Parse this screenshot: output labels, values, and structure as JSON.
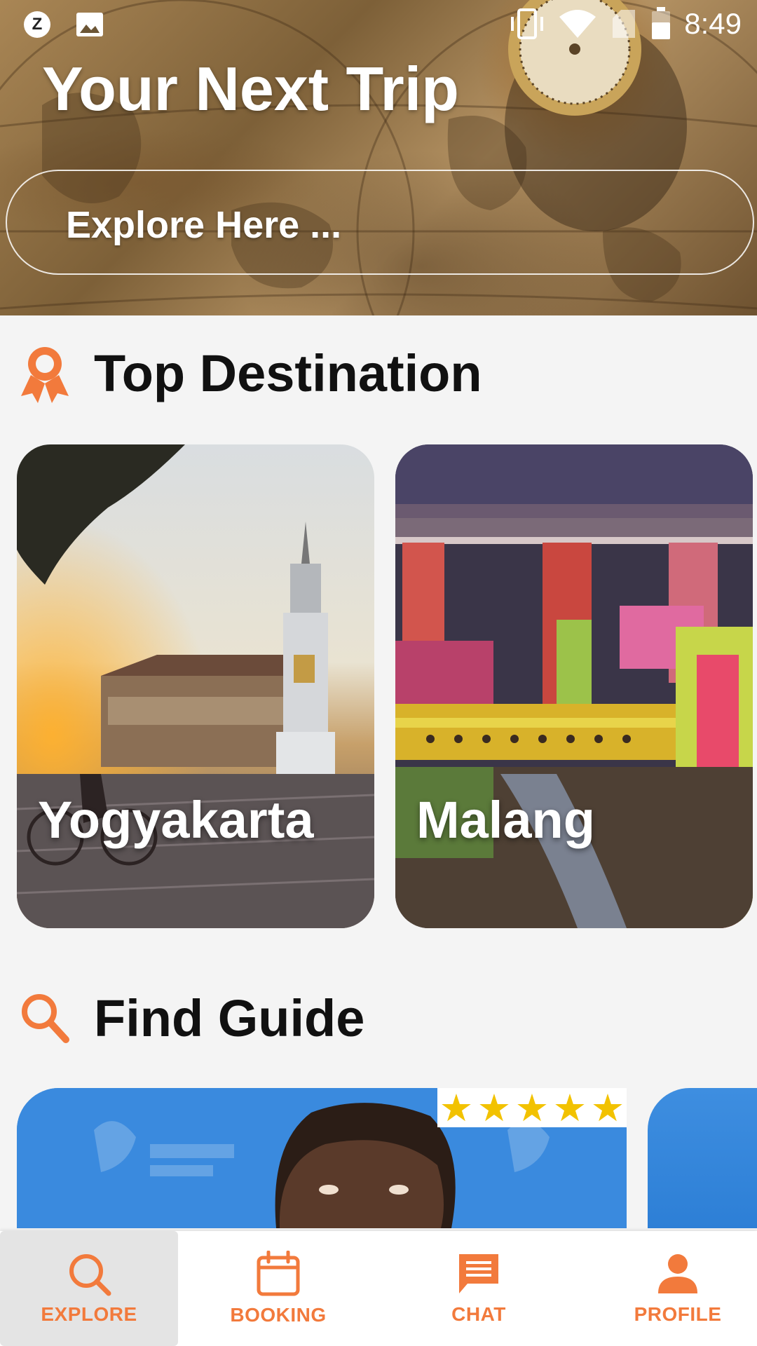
{
  "status_bar": {
    "left_icons": [
      "z-notification-icon",
      "image-icon"
    ],
    "z_letter": "Z",
    "right_icons": [
      "vibrate-icon",
      "wifi-icon",
      "sim-icon",
      "battery-icon"
    ],
    "time": "8:49"
  },
  "hero": {
    "title": "Your Next Trip",
    "search_placeholder": "Explore Here ..."
  },
  "top_destination": {
    "title": "Top Destination",
    "icon": "award-ribbon-icon",
    "cards": [
      {
        "label": "Yogyakarta"
      },
      {
        "label": "Malang"
      }
    ]
  },
  "find_guide": {
    "title": "Find Guide",
    "icon": "search-icon",
    "rating_stars": 5
  },
  "bottom_nav": {
    "items": [
      {
        "label": "EXPLORE",
        "icon": "search-icon",
        "active": true
      },
      {
        "label": "BOOKING",
        "icon": "calendar-icon",
        "active": false
      },
      {
        "label": "CHAT",
        "icon": "chat-icon",
        "active": false
      },
      {
        "label": "PROFILE",
        "icon": "person-icon",
        "active": false
      }
    ]
  },
  "colors": {
    "accent": "#f27a3c",
    "background": "#f4f4f4",
    "star": "#f2c200"
  }
}
